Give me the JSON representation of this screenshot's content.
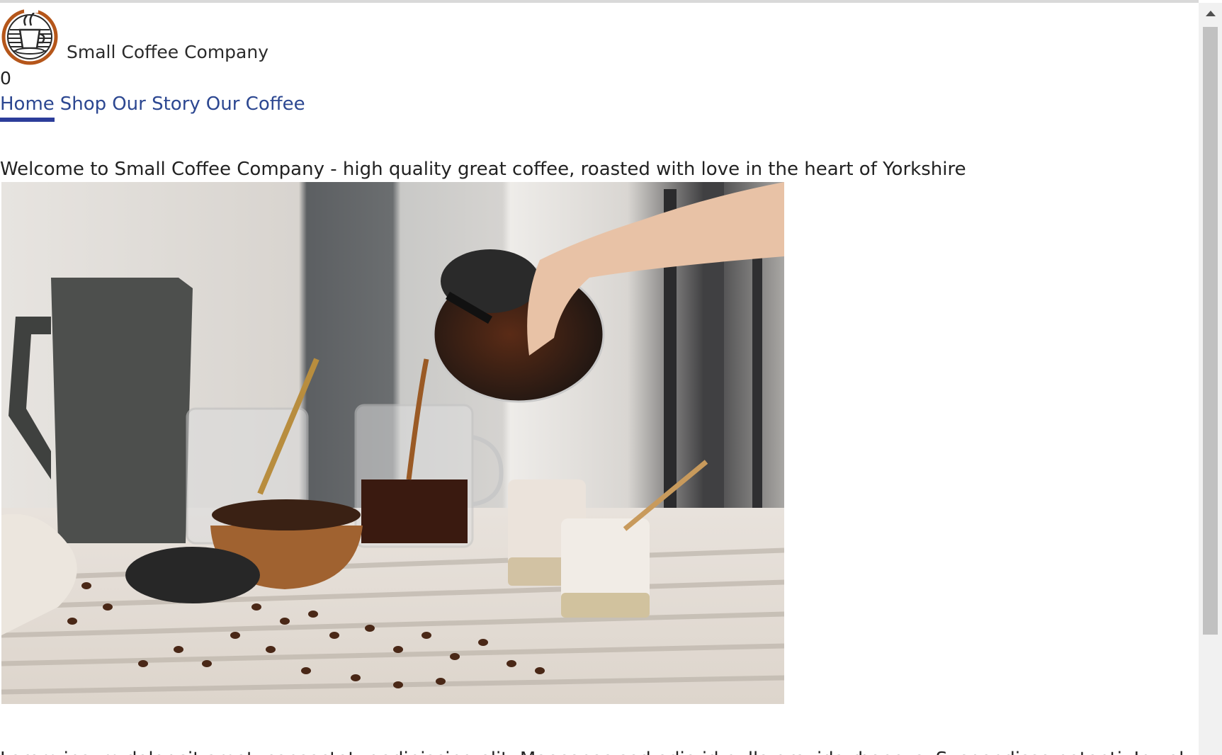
{
  "header": {
    "brand_name": "Small Coffee Company",
    "logo_icon": "coffee-cup-logo-icon"
  },
  "cart": {
    "count": "0"
  },
  "nav": {
    "items": [
      {
        "label": "Home",
        "active": true
      },
      {
        "label": "Shop",
        "active": false
      },
      {
        "label": "Our Story",
        "active": false
      },
      {
        "label": "Our Coffee",
        "active": false
      }
    ]
  },
  "main": {
    "welcome_text": "Welcome to Small Coffee Company - high quality great coffee, roasted with love in the heart of Yorkshire",
    "body_text": "Lorem ipsum dolor sit amet, consectetur adipiscing elit. Maecenas sed odio id nulla gravida rhoncus. Suspendisse potenti. In volutpat nibh"
  },
  "colors": {
    "nav_link": "#2c4791",
    "nav_active_underline": "#2c3d9a",
    "text": "#222222",
    "logo_ring": "#b5561a"
  }
}
